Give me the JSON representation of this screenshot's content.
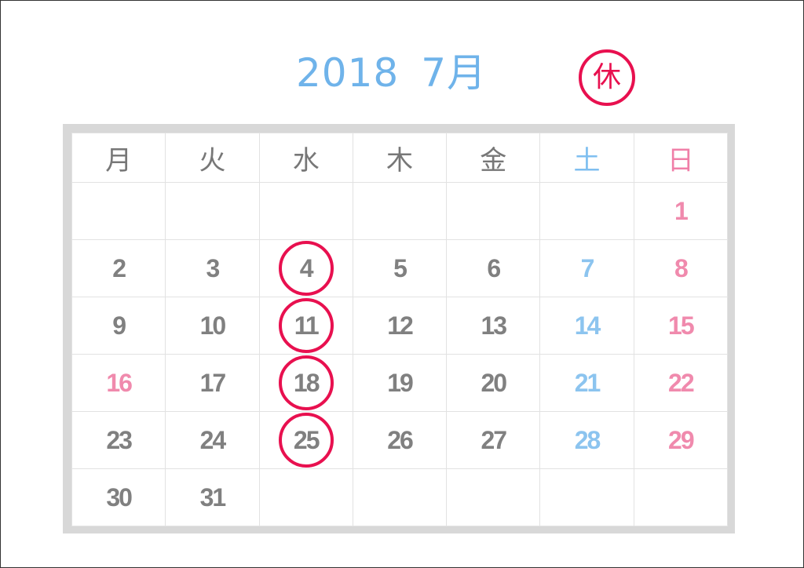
{
  "header": {
    "year": "2018",
    "month": "7月",
    "closed_mark": "休"
  },
  "weekdays": [
    "月",
    "火",
    "水",
    "木",
    "金",
    "土",
    "日"
  ],
  "weeks": [
    [
      "",
      "",
      "",
      "",
      "",
      "",
      "1"
    ],
    [
      "2",
      "3",
      "4",
      "5",
      "6",
      "7",
      "8"
    ],
    [
      "9",
      "10",
      "11",
      "12",
      "13",
      "14",
      "15"
    ],
    [
      "16",
      "17",
      "18",
      "19",
      "20",
      "21",
      "22"
    ],
    [
      "23",
      "24",
      "25",
      "26",
      "27",
      "28",
      "29"
    ],
    [
      "30",
      "31",
      "",
      "",
      "",
      "",
      ""
    ]
  ],
  "closed_days": [
    "4",
    "11",
    "18",
    "25"
  ],
  "holidays": [
    "16"
  ],
  "colors": {
    "title": "#6fb3ea",
    "weekday_text": "#777777",
    "saturday": "#8cc4ef",
    "sunday_holiday": "#f08aad",
    "closed_circle": "#e8104f",
    "frame": "#d8d8d8"
  }
}
